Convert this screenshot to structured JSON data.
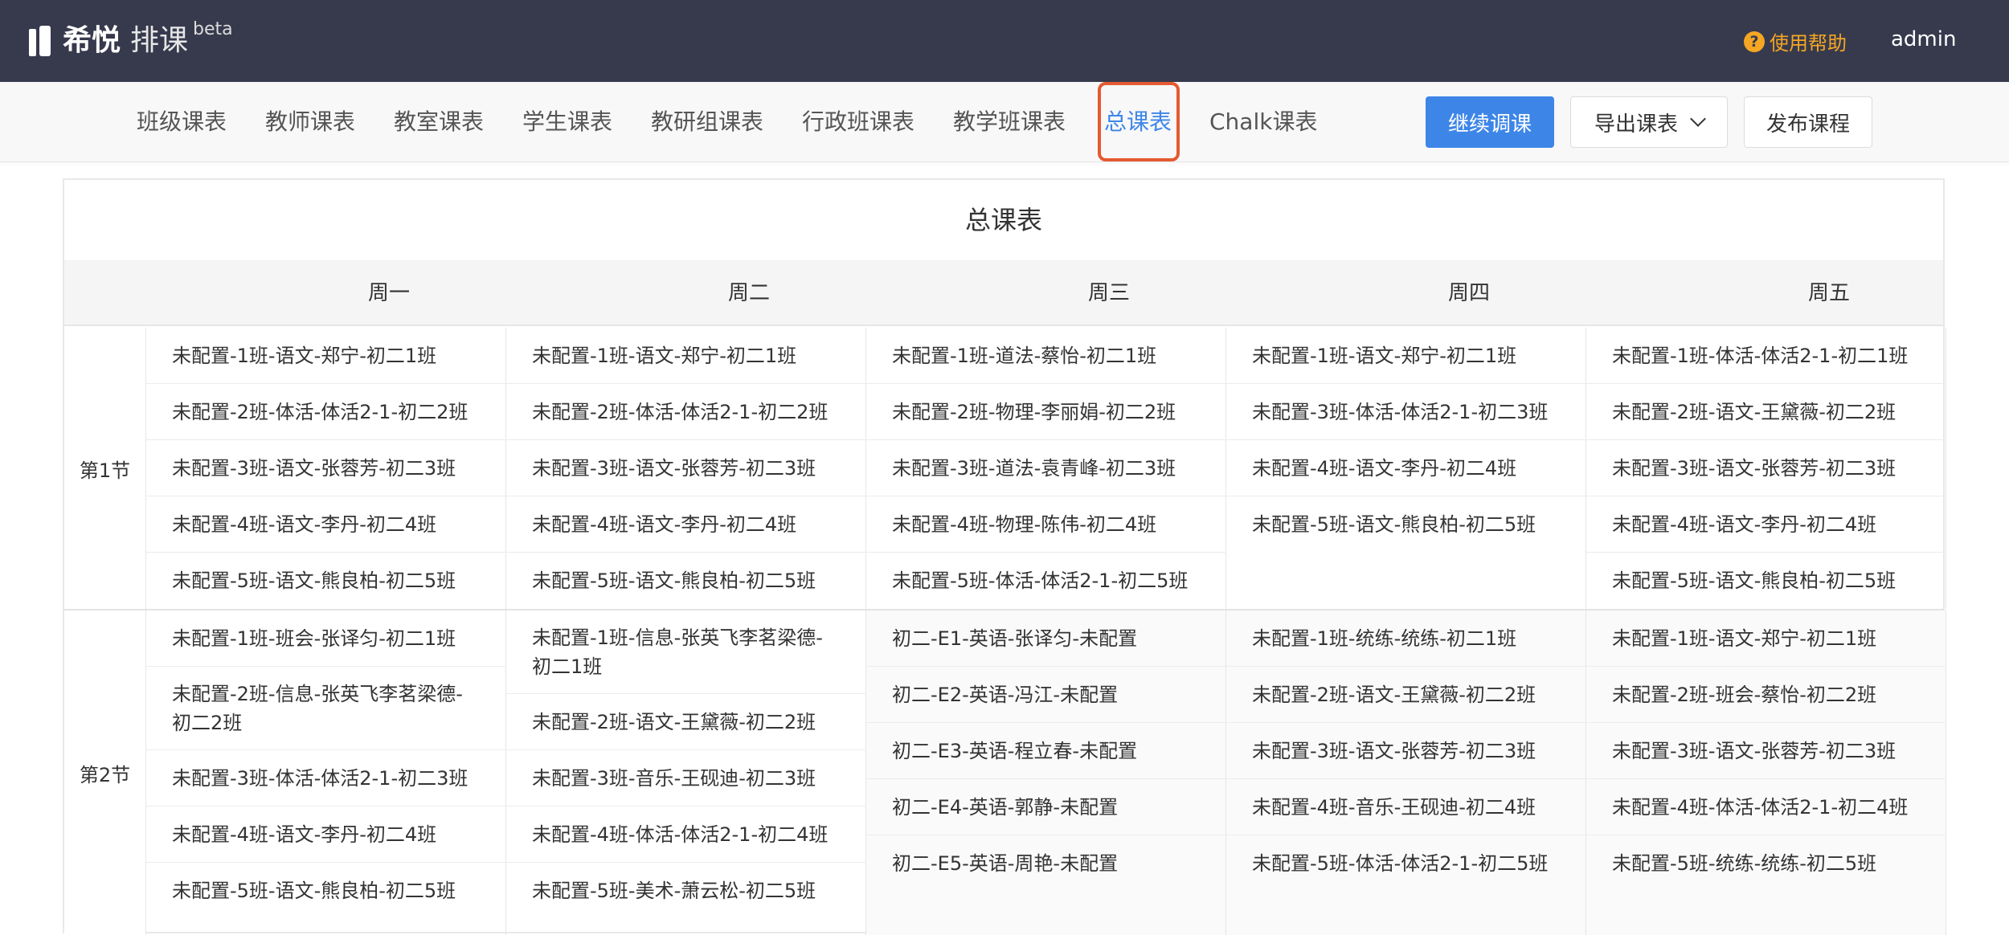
{
  "app": {
    "logo_name": "希悦",
    "logo_sub": "排课",
    "logo_beta": "beta",
    "help_label": "使用帮助",
    "help_icon": "?",
    "user": "admin"
  },
  "nav": {
    "tabs": [
      "班级课表",
      "教师课表",
      "教室课表",
      "学生课表",
      "教研组课表",
      "行政班课表",
      "教学班课表",
      "总课表",
      "Chalk课表"
    ],
    "active_tab": "总课表",
    "continue_button": "继续调课",
    "export_button": "导出课表",
    "publish_button": "发布课程"
  },
  "timetable": {
    "title": "总课表",
    "days": [
      "周一",
      "周二",
      "周三",
      "周四",
      "周五"
    ],
    "periods": [
      {
        "label": "第1节",
        "days": [
          [
            "未配置-1班-语文-郑宁-初二1班",
            "未配置-2班-体活-体活2-1-初二2班",
            "未配置-3班-语文-张蓉芳-初二3班",
            "未配置-4班-语文-李丹-初二4班",
            "未配置-5班-语文-熊良柏-初二5班"
          ],
          [
            "未配置-1班-语文-郑宁-初二1班",
            "未配置-2班-体活-体活2-1-初二2班",
            "未配置-3班-语文-张蓉芳-初二3班",
            "未配置-4班-语文-李丹-初二4班",
            "未配置-5班-语文-熊良柏-初二5班"
          ],
          [
            "未配置-1班-道法-蔡怡-初二1班",
            "未配置-2班-物理-李丽娟-初二2班",
            "未配置-3班-道法-袁青峰-初二3班",
            "未配置-4班-物理-陈伟-初二4班",
            "未配置-5班-体活-体活2-1-初二5班"
          ],
          [
            "未配置-1班-语文-郑宁-初二1班",
            "未配置-3班-体活-体活2-1-初二3班",
            "未配置-4班-语文-李丹-初二4班",
            "未配置-5班-语文-熊良柏-初二5班"
          ],
          [
            "未配置-1班-体活-体活2-1-初二1班",
            "未配置-2班-语文-王黛薇-初二2班",
            "未配置-3班-语文-张蓉芳-初二3班",
            "未配置-4班-语文-李丹-初二4班",
            "未配置-5班-语文-熊良柏-初二5班"
          ]
        ]
      },
      {
        "label": "第2节",
        "days": [
          [
            "未配置-1班-班会-张译匀-初二1班",
            "未配置-2班-信息-张英飞李茗梁德-初二2班",
            "未配置-3班-体活-体活2-1-初二3班",
            "未配置-4班-语文-李丹-初二4班",
            "未配置-5班-语文-熊良柏-初二5班"
          ],
          [
            "未配置-1班-信息-张英飞李茗梁德-初二1班",
            "未配置-2班-语文-王黛薇-初二2班",
            "未配置-3班-音乐-王砚迪-初二3班",
            "未配置-4班-体活-体活2-1-初二4班",
            "未配置-5班-美术-萧云松-初二5班"
          ],
          [
            "初二-E1-英语-张译匀-未配置",
            "初二-E2-英语-冯江-未配置",
            "初二-E3-英语-程立春-未配置",
            "初二-E4-英语-郭静-未配置",
            "初二-E5-英语-周艳-未配置"
          ],
          [
            "未配置-1班-统练-统练-初二1班",
            "未配置-2班-语文-王黛薇-初二2班",
            "未配置-3班-语文-张蓉芳-初二3班",
            "未配置-4班-音乐-王砚迪-初二4班",
            "未配置-5班-体活-体活2-1-初二5班"
          ],
          [
            "未配置-1班-语文-郑宁-初二1班",
            "未配置-2班-班会-蔡怡-初二2班",
            "未配置-3班-语文-张蓉芳-初二3班",
            "未配置-4班-体活-体活2-1-初二4班",
            "未配置-5班-统练-统练-初二5班"
          ]
        ]
      }
    ]
  },
  "colors": {
    "topbar": "#373a4d",
    "accent": "#3d86e8",
    "help": "#f5a623",
    "highlight": "#e55a32"
  }
}
